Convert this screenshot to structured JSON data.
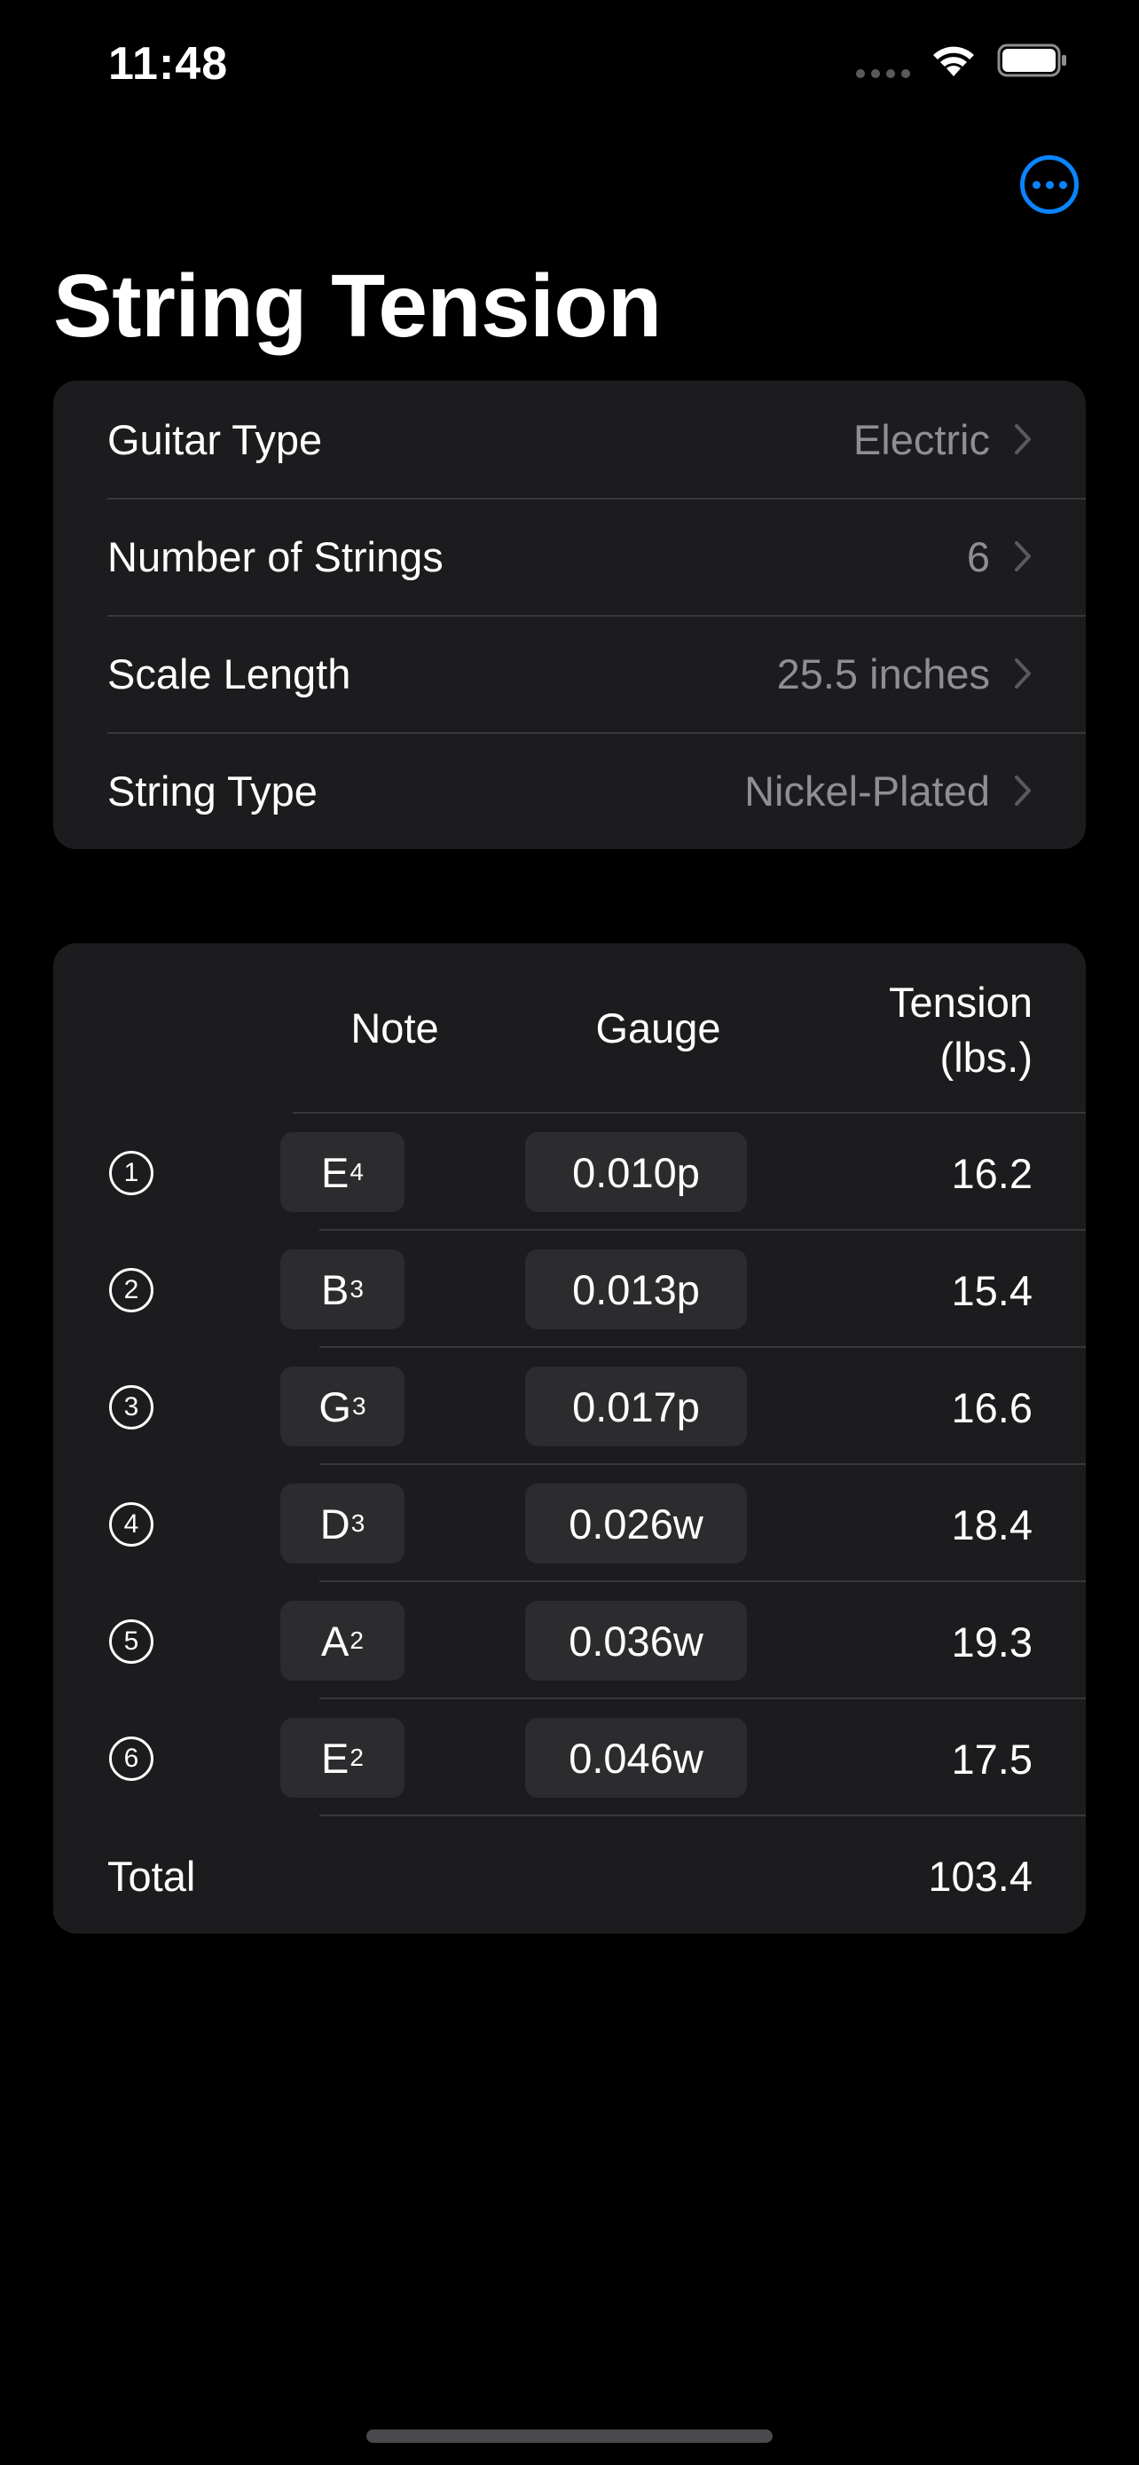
{
  "status_bar": {
    "time": "11:48"
  },
  "colors": {
    "accent": "#0a84ff",
    "background": "#000000",
    "card": "#1c1c1e",
    "pill": "#2c2c2e",
    "secondary_text": "#8e8e93"
  },
  "page": {
    "title": "String Tension"
  },
  "settings": [
    {
      "label": "Guitar Type",
      "value": "Electric"
    },
    {
      "label": "Number of Strings",
      "value": "6"
    },
    {
      "label": "Scale Length",
      "value": "25.5 inches"
    },
    {
      "label": "String Type",
      "value": "Nickel-Plated"
    }
  ],
  "table": {
    "headers": {
      "note": "Note",
      "gauge": "Gauge",
      "tension_line1": "Tension",
      "tension_line2": "(lbs.)"
    },
    "rows": [
      {
        "number": "1",
        "note": "E",
        "octave": "4",
        "gauge": "0.010p",
        "tension": "16.2"
      },
      {
        "number": "2",
        "note": "B",
        "octave": "3",
        "gauge": "0.013p",
        "tension": "15.4"
      },
      {
        "number": "3",
        "note": "G",
        "octave": "3",
        "gauge": "0.017p",
        "tension": "16.6"
      },
      {
        "number": "4",
        "note": "D",
        "octave": "3",
        "gauge": "0.026w",
        "tension": "18.4"
      },
      {
        "number": "5",
        "note": "A",
        "octave": "2",
        "gauge": "0.036w",
        "tension": "19.3"
      },
      {
        "number": "6",
        "note": "E",
        "octave": "2",
        "gauge": "0.046w",
        "tension": "17.5"
      }
    ],
    "total_label": "Total",
    "total_value": "103.4"
  }
}
